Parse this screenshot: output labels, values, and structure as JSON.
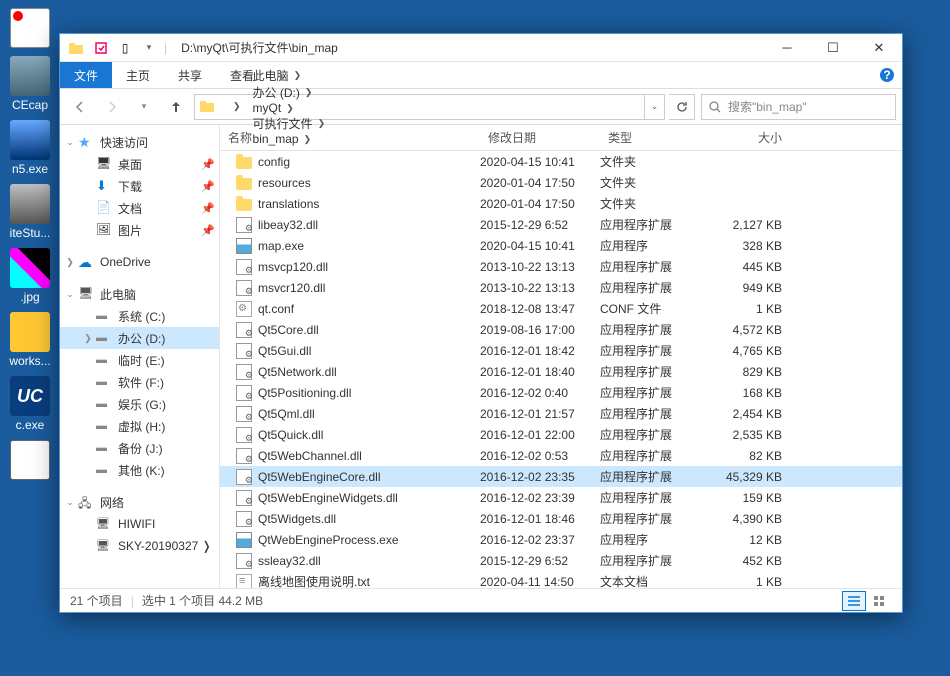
{
  "desktop": {
    "items": [
      "",
      "CEcap",
      "n5.exe",
      "iteStu...",
      ".jpg",
      "works...",
      "c.exe",
      ""
    ]
  },
  "window": {
    "title_path": "D:\\myQt\\可执行文件\\bin_map",
    "ribbon": {
      "file": "文件",
      "tabs": [
        "主页",
        "共享",
        "查看"
      ]
    },
    "breadcrumb": [
      "此电脑",
      "办公 (D:)",
      "myQt",
      "可执行文件",
      "bin_map"
    ],
    "search_placeholder": "搜索\"bin_map\"",
    "columns": {
      "name": "名称",
      "date": "修改日期",
      "type": "类型",
      "size": "大小"
    },
    "nav": {
      "quick": "快速访问",
      "quick_items": [
        {
          "label": "桌面",
          "icon": "ni-desk",
          "pin": true
        },
        {
          "label": "下载",
          "icon": "ni-dl",
          "pin": true
        },
        {
          "label": "文档",
          "icon": "ni-doc",
          "pin": true
        },
        {
          "label": "图片",
          "icon": "ni-pic",
          "pin": true
        }
      ],
      "onedrive": "OneDrive",
      "thispc": "此电脑",
      "drives": [
        "系统 (C:)",
        "办公 (D:)",
        "临时 (E:)",
        "软件 (F:)",
        "娱乐 (G:)",
        "虚拟 (H:)",
        "备份 (J:)",
        "其他 (K:)"
      ],
      "selected_drive": 1,
      "network": "网络",
      "net_items": [
        "HIWIFI",
        "SKY-20190327 ❭"
      ]
    },
    "files": [
      {
        "name": "config",
        "date": "2020-04-15 10:41",
        "type": "文件夹",
        "size": "",
        "icon": "fi-fold"
      },
      {
        "name": "resources",
        "date": "2020-01-04 17:50",
        "type": "文件夹",
        "size": "",
        "icon": "fi-fold"
      },
      {
        "name": "translations",
        "date": "2020-01-04 17:50",
        "type": "文件夹",
        "size": "",
        "icon": "fi-fold"
      },
      {
        "name": "libeay32.dll",
        "date": "2015-12-29 6:52",
        "type": "应用程序扩展",
        "size": "2,127 KB",
        "icon": "fi-dll"
      },
      {
        "name": "map.exe",
        "date": "2020-04-15 10:41",
        "type": "应用程序",
        "size": "328 KB",
        "icon": "fi-exe"
      },
      {
        "name": "msvcp120.dll",
        "date": "2013-10-22 13:13",
        "type": "应用程序扩展",
        "size": "445 KB",
        "icon": "fi-dll"
      },
      {
        "name": "msvcr120.dll",
        "date": "2013-10-22 13:13",
        "type": "应用程序扩展",
        "size": "949 KB",
        "icon": "fi-dll"
      },
      {
        "name": "qt.conf",
        "date": "2018-12-08 13:47",
        "type": "CONF 文件",
        "size": "1 KB",
        "icon": "fi-conf"
      },
      {
        "name": "Qt5Core.dll",
        "date": "2019-08-16 17:00",
        "type": "应用程序扩展",
        "size": "4,572 KB",
        "icon": "fi-dll"
      },
      {
        "name": "Qt5Gui.dll",
        "date": "2016-12-01 18:42",
        "type": "应用程序扩展",
        "size": "4,765 KB",
        "icon": "fi-dll"
      },
      {
        "name": "Qt5Network.dll",
        "date": "2016-12-01 18:40",
        "type": "应用程序扩展",
        "size": "829 KB",
        "icon": "fi-dll"
      },
      {
        "name": "Qt5Positioning.dll",
        "date": "2016-12-02 0:40",
        "type": "应用程序扩展",
        "size": "168 KB",
        "icon": "fi-dll"
      },
      {
        "name": "Qt5Qml.dll",
        "date": "2016-12-01 21:57",
        "type": "应用程序扩展",
        "size": "2,454 KB",
        "icon": "fi-dll"
      },
      {
        "name": "Qt5Quick.dll",
        "date": "2016-12-01 22:00",
        "type": "应用程序扩展",
        "size": "2,535 KB",
        "icon": "fi-dll"
      },
      {
        "name": "Qt5WebChannel.dll",
        "date": "2016-12-02 0:53",
        "type": "应用程序扩展",
        "size": "82 KB",
        "icon": "fi-dll"
      },
      {
        "name": "Qt5WebEngineCore.dll",
        "date": "2016-12-02 23:35",
        "type": "应用程序扩展",
        "size": "45,329 KB",
        "icon": "fi-dll",
        "selected": true
      },
      {
        "name": "Qt5WebEngineWidgets.dll",
        "date": "2016-12-02 23:39",
        "type": "应用程序扩展",
        "size": "159 KB",
        "icon": "fi-dll"
      },
      {
        "name": "Qt5Widgets.dll",
        "date": "2016-12-01 18:46",
        "type": "应用程序扩展",
        "size": "4,390 KB",
        "icon": "fi-dll"
      },
      {
        "name": "QtWebEngineProcess.exe",
        "date": "2016-12-02 23:37",
        "type": "应用程序",
        "size": "12 KB",
        "icon": "fi-exe"
      },
      {
        "name": "ssleay32.dll",
        "date": "2015-12-29 6:52",
        "type": "应用程序扩展",
        "size": "452 KB",
        "icon": "fi-dll"
      },
      {
        "name": "离线地图使用说明.txt",
        "date": "2020-04-11 14:50",
        "type": "文本文档",
        "size": "1 KB",
        "icon": "fi-txt"
      }
    ],
    "status": {
      "count": "21 个项目",
      "selection": "选中 1 个项目  44.2 MB"
    }
  }
}
